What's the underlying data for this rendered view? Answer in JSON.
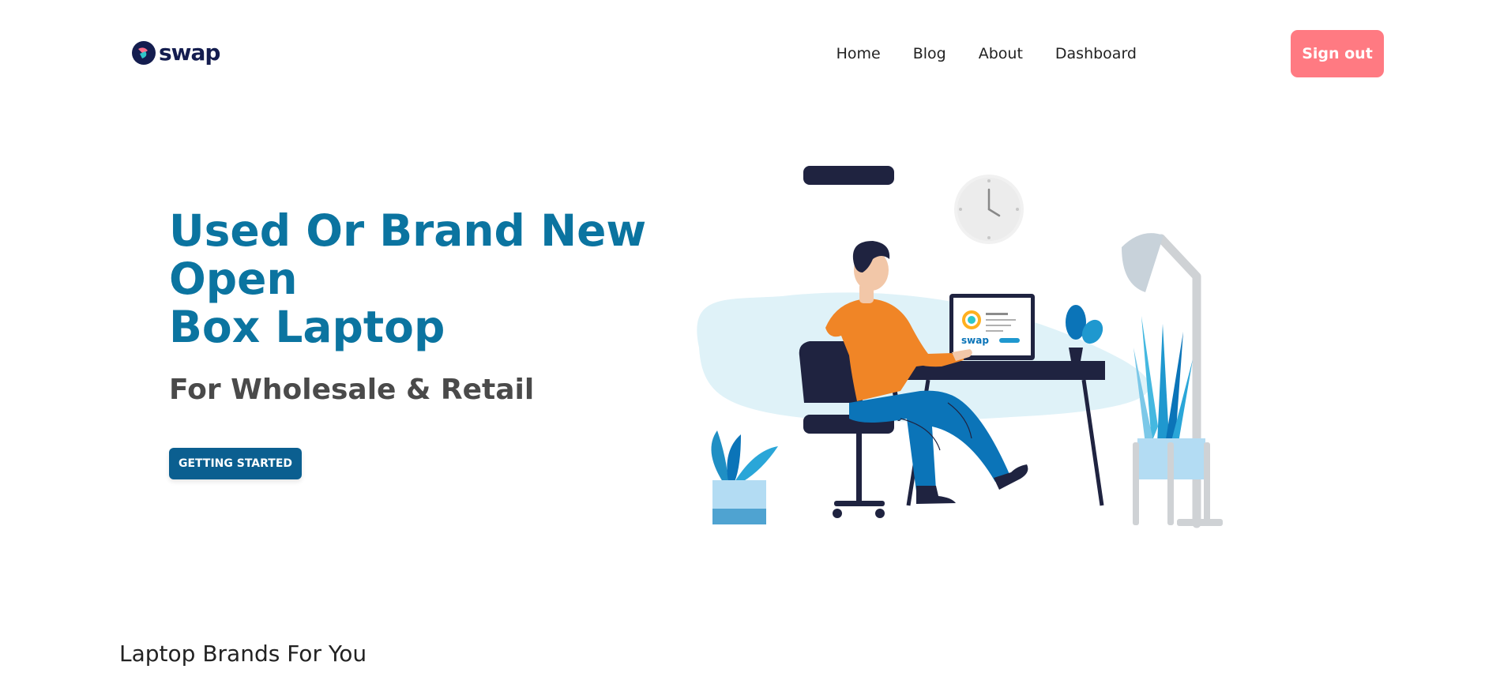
{
  "brand": {
    "name": "swap"
  },
  "nav": {
    "links": [
      "Home",
      "Blog",
      "About",
      "Dashboard"
    ],
    "signout_label": "Sign out"
  },
  "hero": {
    "title_lines": [
      "Used Or Brand New",
      "Open",
      "Box Laptop"
    ],
    "subtitle": "For Wholesale & Retail",
    "cta_label": "GETTING STARTED",
    "screen_logo_text": "swap"
  },
  "section": {
    "title": "Laptop Brands For You"
  },
  "colors": {
    "primary": "#0b74a0",
    "button": "#0b5f90",
    "signout": "#ff7a82",
    "brand_dark": "#141d4f"
  }
}
